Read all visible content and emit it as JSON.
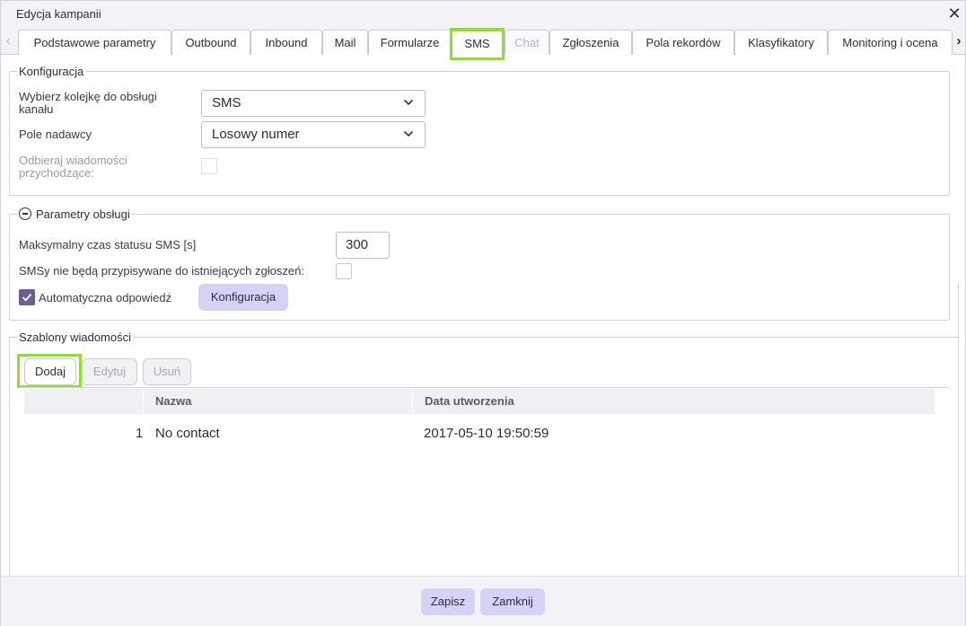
{
  "dialog": {
    "title": "Edycja kampanii"
  },
  "tabs": [
    {
      "label": "Podstawowe parametry",
      "state": "normal"
    },
    {
      "label": "Outbound",
      "state": "normal"
    },
    {
      "label": "Inbound",
      "state": "normal"
    },
    {
      "label": "Mail",
      "state": "normal"
    },
    {
      "label": "Formularze",
      "state": "normal"
    },
    {
      "label": "SMS",
      "state": "active"
    },
    {
      "label": "Chat",
      "state": "disabled"
    },
    {
      "label": "Zgłoszenia",
      "state": "normal"
    },
    {
      "label": "Pola rekordów",
      "state": "normal"
    },
    {
      "label": "Klasyfikatory",
      "state": "normal"
    },
    {
      "label": "Monitoring i ocena",
      "state": "normal"
    }
  ],
  "konfiguracja": {
    "legend": "Konfiguracja",
    "queue_label": "Wybierz kolejkę do obsługi kanału",
    "queue_value": "SMS",
    "sender_label": "Pole nadawcy",
    "sender_value": "Losowy numer",
    "receive_label": "Odbieraj wiadomości przychodzące:",
    "receive_checked": false
  },
  "parametry": {
    "legend": "Parametry obsługi",
    "max_time_label": "Maksymalny czas statusu SMS [s]",
    "max_time_value": "300",
    "no_assign_label": "SMSy nie będą przypisywane do istniejących zgłoszeń:",
    "no_assign_checked": false,
    "auto_reply_label": "Automatyczna odpowiedź",
    "auto_reply_checked": true,
    "config_button": "Konfiguracja"
  },
  "szablony": {
    "legend": "Szablony wiadomości",
    "add_button": "Dodaj",
    "edit_button": "Edytuj",
    "delete_button": "Usuń",
    "columns": [
      "Nazwa",
      "Data utworzenia"
    ],
    "rows": [
      {
        "index": "1",
        "name": "No contact",
        "created": "2017-05-10 19:50:59"
      }
    ]
  },
  "footer": {
    "save_button": "Zapisz",
    "close_button": "Zamknij"
  },
  "colors": {
    "accent": "#d4d2f7",
    "highlight": "#8ee02a",
    "checkbox": "#6d5d93"
  },
  "icons": {
    "close": "close-icon",
    "prev": "chevron-left-icon",
    "next": "chevron-right-icon",
    "dropdown": "chevron-down-icon",
    "collapse": "minus-circle-icon",
    "check": "checkmark-icon"
  }
}
